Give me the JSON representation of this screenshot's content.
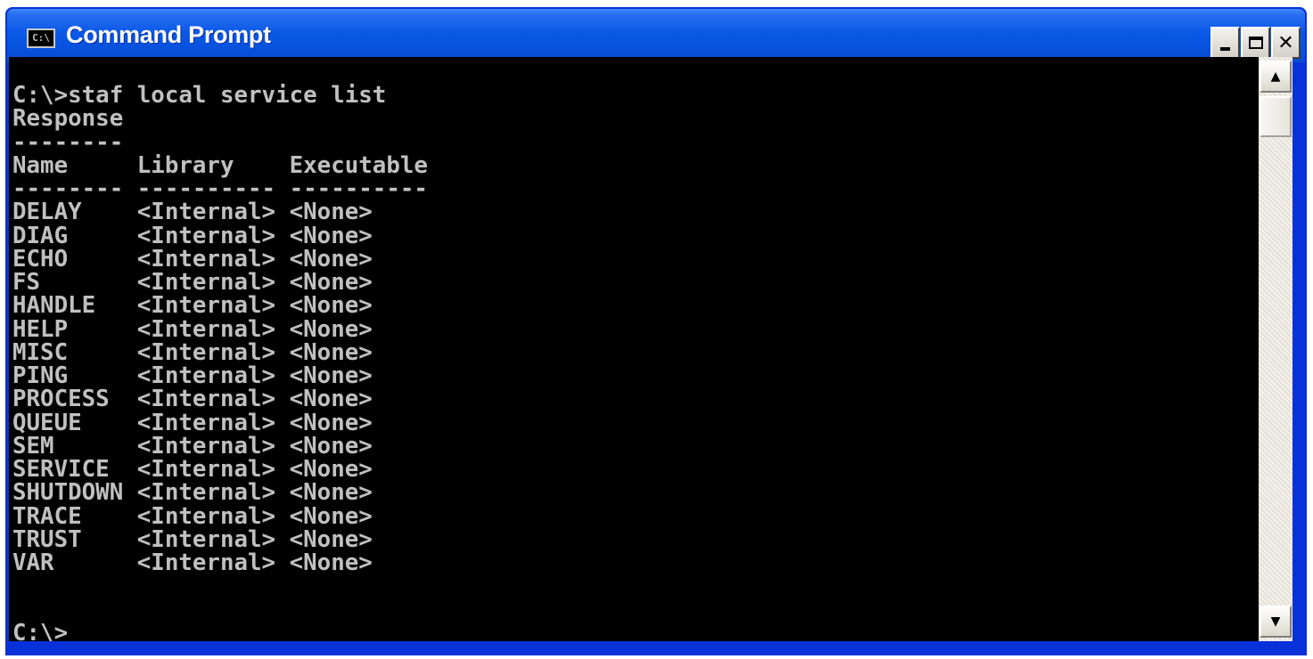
{
  "window": {
    "title": "Command Prompt",
    "icon_label": "C:\\",
    "accent_color": "#0a58e6"
  },
  "titlebar_buttons": {
    "minimize": "minimize-icon",
    "maximize": "maximize-icon",
    "close": "close-icon",
    "close_glyph": "✕"
  },
  "console": {
    "lines": [
      "C:\\>staf local service list",
      "Response",
      "--------",
      "Name     Library    Executable",
      "-------- ---------- ----------",
      "DELAY    <Internal> <None>",
      "DIAG     <Internal> <None>",
      "ECHO     <Internal> <None>",
      "FS       <Internal> <None>",
      "HANDLE   <Internal> <None>",
      "HELP     <Internal> <None>",
      "MISC     <Internal> <None>",
      "PING     <Internal> <None>",
      "PROCESS  <Internal> <None>",
      "QUEUE    <Internal> <None>",
      "SEM      <Internal> <None>",
      "SERVICE  <Internal> <None>",
      "SHUTDOWN <Internal> <None>",
      "TRACE    <Internal> <None>",
      "TRUST    <Internal> <None>",
      "VAR      <Internal> <None>",
      "",
      "",
      "C:\\>"
    ]
  },
  "scrollbar": {
    "up_arrow": "▲",
    "down_arrow": "▼"
  }
}
